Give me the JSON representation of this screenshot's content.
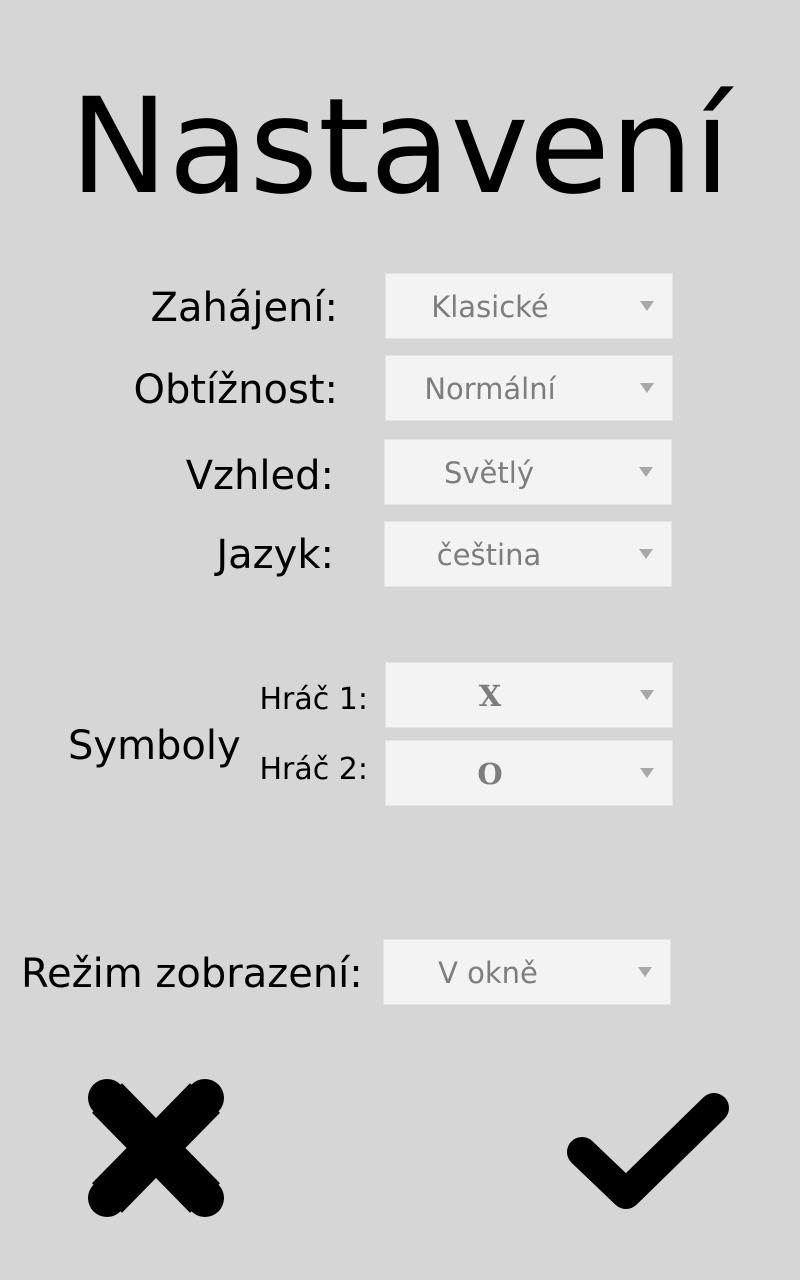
{
  "page": {
    "title": "Nastavení"
  },
  "settings": {
    "opening": {
      "label": "Zahájení:",
      "value": "Klasické"
    },
    "difficulty": {
      "label": "Obtížnost:",
      "value": "Normální"
    },
    "appearance": {
      "label": "Vzhled:",
      "value": "Světlý"
    },
    "language": {
      "label": "Jazyk:",
      "value": "čeština"
    }
  },
  "symbols": {
    "label": "Symboly",
    "player1": {
      "label": "Hráč 1:",
      "value": "X",
      "color": "#1030ff"
    },
    "player2": {
      "label": "Hráč 2:",
      "value": "O",
      "color": "#b50000"
    }
  },
  "display_mode": {
    "label": "Režim zobrazení:",
    "value": "V okně"
  },
  "actions": {
    "cancel_icon": "close-icon",
    "confirm_icon": "checkmark-icon"
  }
}
